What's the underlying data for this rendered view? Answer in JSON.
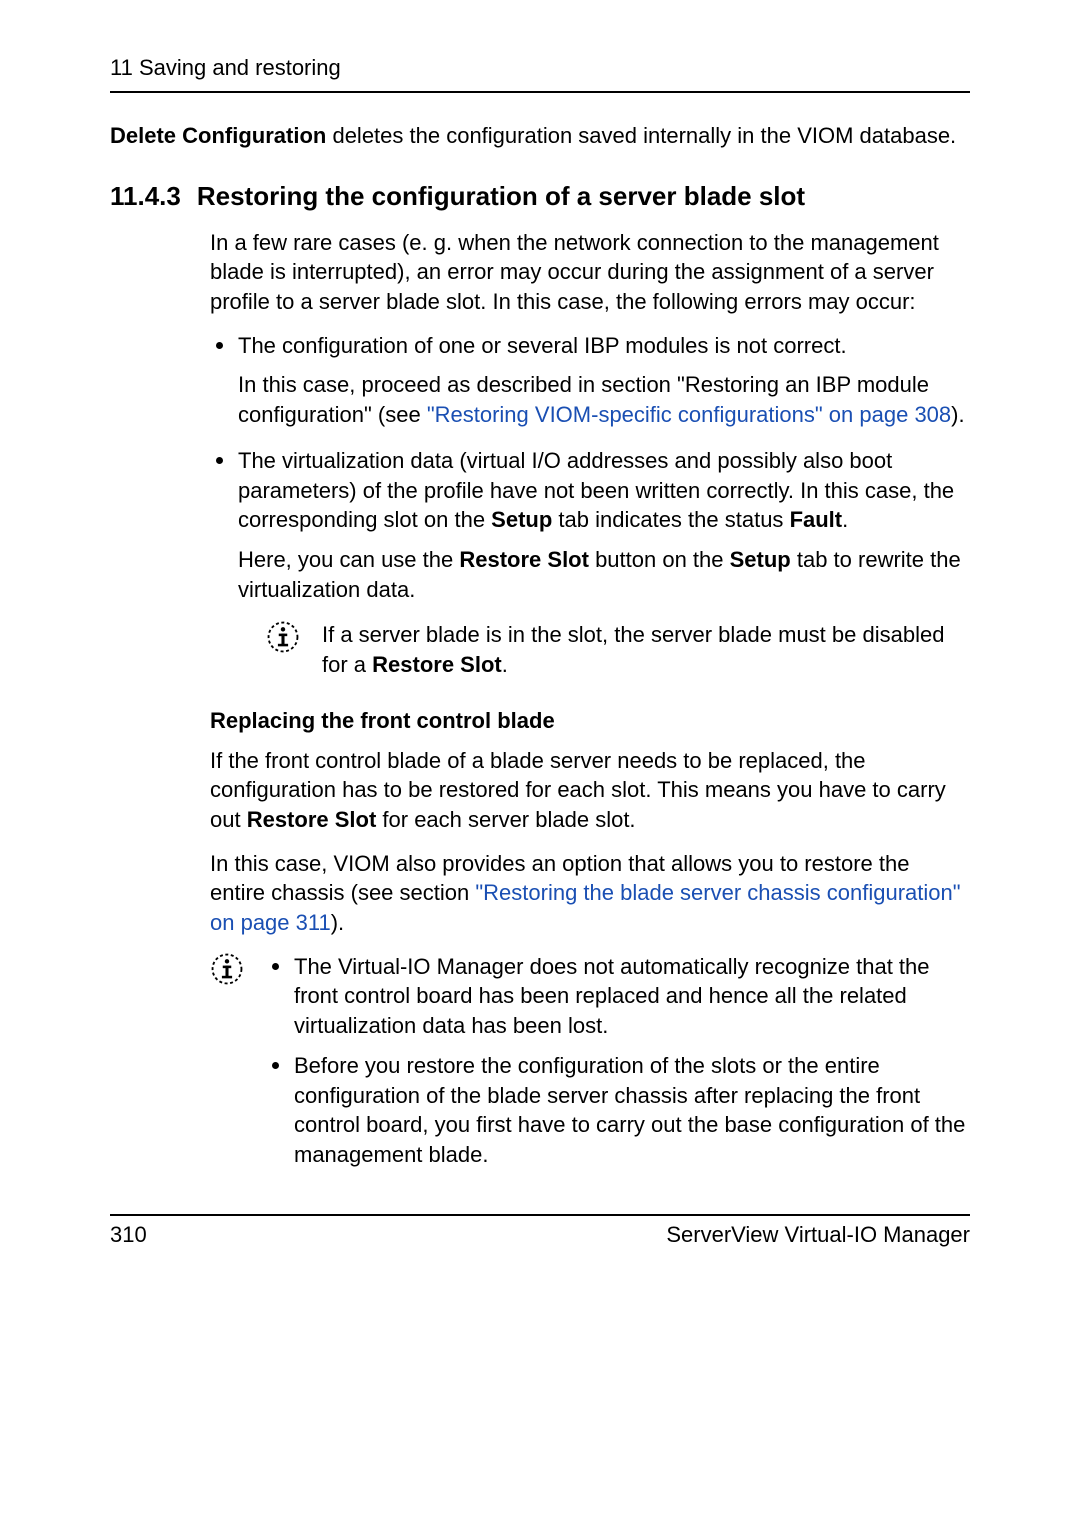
{
  "header": {
    "running": "11 Saving and restoring"
  },
  "intro": {
    "bold": "Delete Configuration",
    "rest": " deletes the configuration saved internally in the VIOM database."
  },
  "section": {
    "number": "11.4.3",
    "title": "Restoring the configuration of a server blade slot",
    "lead": "In a few rare cases (e. g. when the network connection to the management blade is interrupted), an error may occur during the assignment of a server profile to a server blade slot. In this case, the following errors may occur:",
    "bullet1": {
      "main": "The configuration of one or several IBP modules is not correct.",
      "sub_pre": "In this case, proceed as described in section \"Restoring an IBP module configuration\" (see ",
      "sub_link": "\"Restoring VIOM-specific configurations\" on page 308",
      "sub_post": ")."
    },
    "bullet2": {
      "text_pre1": "The virtualization data (virtual I/O addresses and possibly also boot parameters) of the profile have not been written correctly. In this case, the corresponding slot on the ",
      "b_setup1": "Setup",
      "text_mid1": " tab indicates the status ",
      "b_fault": "Fault",
      "text_end1": ".",
      "sub_pre2": "Here, you can use the ",
      "b_restore": "Restore Slot",
      "sub_mid2a": " button on the ",
      "b_setup2": "Setup",
      "sub_end2": " tab to rewrite the virtualization data.",
      "info_pre": "If a server blade is in the slot, the server blade must be disabled for a ",
      "b_restore2": "Restore Slot",
      "info_end": "."
    },
    "replace": {
      "heading": "Replacing the front control blade",
      "p1_pre": "If the front control blade of a blade server needs to be replaced, the configuration has to be restored for each slot. This means you have to carry out ",
      "b_restore3": "Restore Slot",
      "p1_post": " for each server blade slot.",
      "p2_pre": "In this case, VIOM also provides an option that allows you to restore the entire chassis (see section ",
      "p2_link": "\"Restoring the blade server chassis configuration\" on page 311",
      "p2_post": ").",
      "info_bullets": {
        "b1": "The Virtual-IO Manager does not automatically recognize that the front control board has been replaced and hence all the related virtualization data has been lost.",
        "b2": "Before you restore the configuration of the slots or the entire configuration of the blade server chassis after replacing the front control board, you first have to carry out the base configuration of the management blade."
      }
    }
  },
  "footer": {
    "page": "310",
    "product": "ServerView Virtual-IO Manager"
  }
}
